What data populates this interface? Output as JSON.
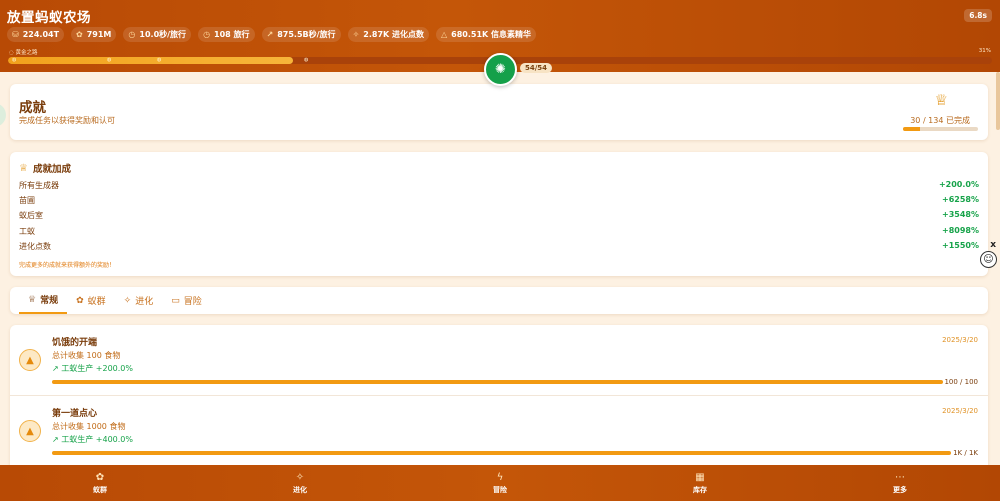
{
  "header": {
    "title": "放置蚂蚁农场",
    "timer": "6.8s",
    "stats": [
      {
        "icon": "food-icon",
        "glyph": "⛁",
        "value": "224.04T"
      },
      {
        "icon": "ant-icon",
        "glyph": "✿",
        "value": "791M"
      },
      {
        "icon": "clock-icon",
        "glyph": "◷",
        "value": "10.0秒/旅行"
      },
      {
        "icon": "clock-icon",
        "glyph": "◷",
        "value": "108 旅行"
      },
      {
        "icon": "trend-icon",
        "glyph": "↗",
        "value": "875.5B秒/旅行"
      },
      {
        "icon": "evolution-icon",
        "glyph": "✧",
        "value": "2.87K 进化点数"
      },
      {
        "icon": "essence-icon",
        "glyph": "△",
        "value": "680.51K 信息素精华"
      }
    ],
    "stage_label": "◌ 黄金之路",
    "stage_percent": "31%",
    "stage_progress": 0.29,
    "center_count": "54/54"
  },
  "hero": {
    "title": "成就",
    "subtitle": "完成任务以获得奖励和认可",
    "progress_text": "30 / 134 已完成",
    "progress": 0.22
  },
  "bonus": {
    "title": "成就加成",
    "rows": [
      {
        "label": "所有生成器",
        "value": "+200.0%"
      },
      {
        "label": "苗圃",
        "value": "+6258%"
      },
      {
        "label": "蚁后室",
        "value": "+3548%"
      },
      {
        "label": "工蚁",
        "value": "+8098%"
      },
      {
        "label": "进化点数",
        "value": "+1550%"
      }
    ],
    "footer": "完成更多的成就来获得额外的奖励！"
  },
  "tabs": [
    {
      "label": "常规",
      "icon": "trophy-icon",
      "glyph": "♕",
      "active": true
    },
    {
      "label": "蚁群",
      "icon": "ant-icon",
      "glyph": "✿",
      "active": false
    },
    {
      "label": "进化",
      "icon": "sparkle-icon",
      "glyph": "✧",
      "active": false
    },
    {
      "label": "冒险",
      "icon": "map-icon",
      "glyph": "▭",
      "active": false
    }
  ],
  "achievements": [
    {
      "name": "饥饿的开端",
      "date": "2025/3/20",
      "desc": "总计收集 100 食物",
      "reward": "↗ 工蚁生产 +200.0%",
      "count": "100 / 100",
      "progress": 1.0
    },
    {
      "name": "第一道点心",
      "date": "2025/3/20",
      "desc": "总计收集 1000 食物",
      "reward": "↗ 工蚁生产 +400.0%",
      "count": "1K / 1K",
      "progress": 1.0
    }
  ],
  "nav": [
    {
      "label": "蚁群",
      "icon": "ant-icon",
      "glyph": "✿"
    },
    {
      "label": "进化",
      "icon": "sparkle-icon",
      "glyph": "✧"
    },
    {
      "label": "冒险",
      "icon": "lightning-icon",
      "glyph": "ϟ"
    },
    {
      "label": "库存",
      "icon": "grid-icon",
      "glyph": "▦"
    },
    {
      "label": "更多",
      "icon": "more-icon",
      "glyph": "⋯"
    }
  ],
  "colors": {
    "accent": "#f29a12",
    "header": "#b84a05",
    "positive": "#17a34a",
    "text": "#7a3d0c"
  }
}
